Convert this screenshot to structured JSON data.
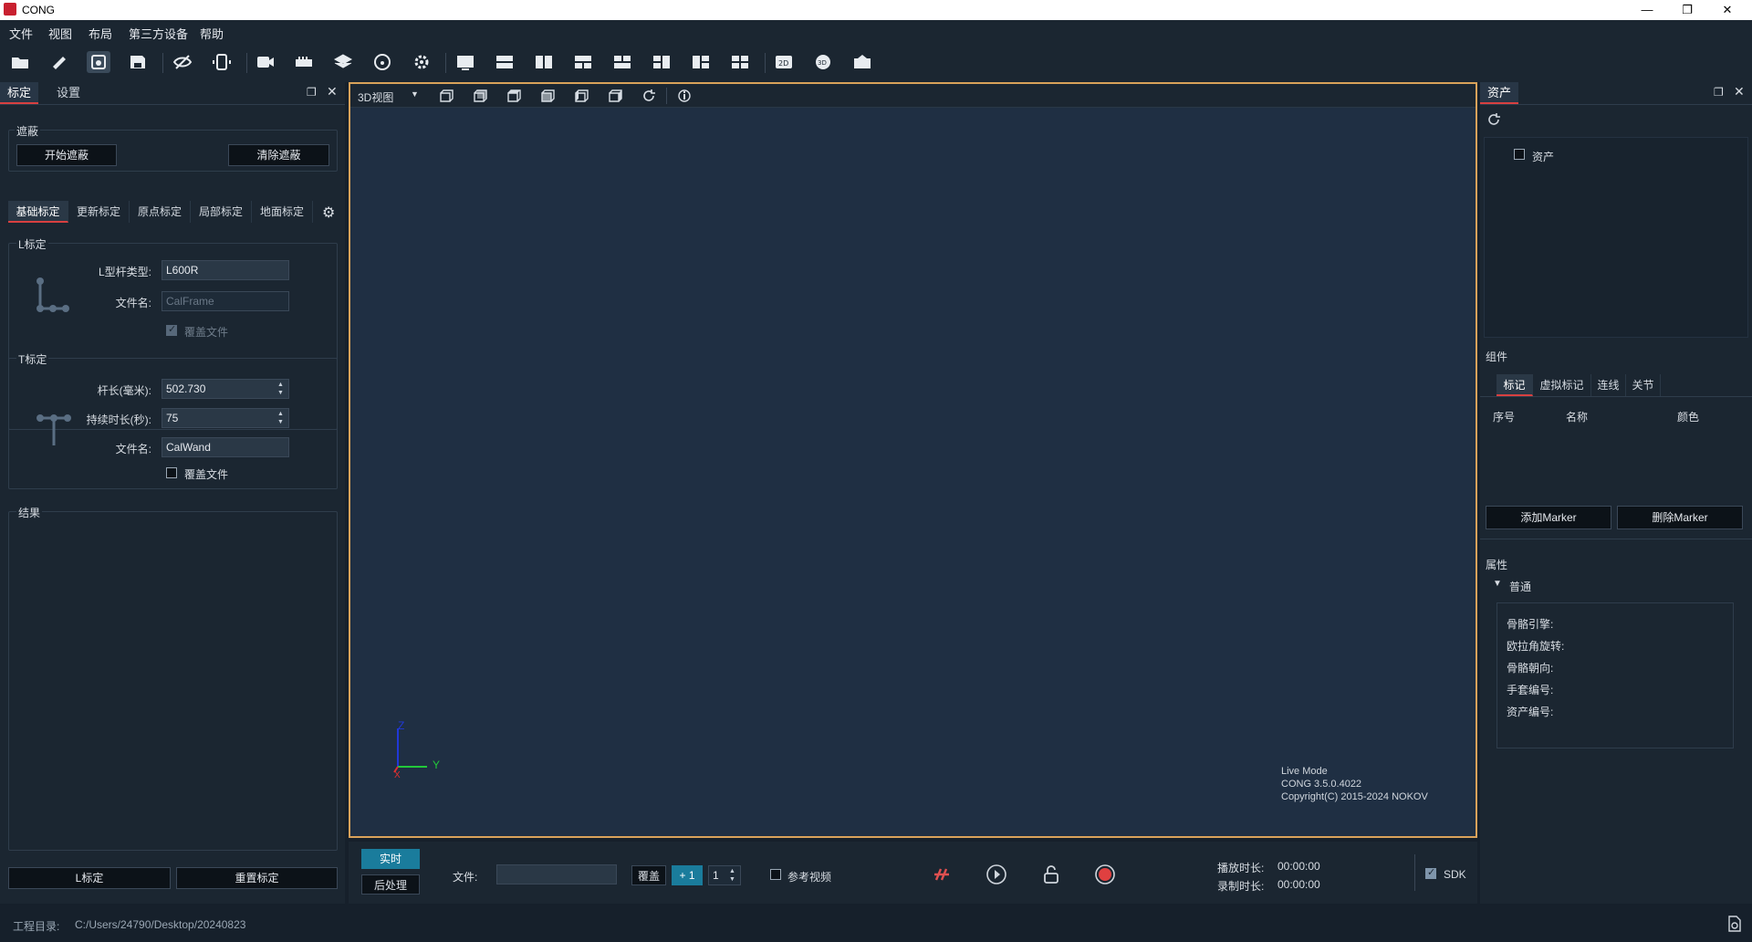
{
  "window": {
    "title": "CONG",
    "minimize": "—",
    "maximize": "❐",
    "close": "✕"
  },
  "menu": [
    "文件",
    "视图",
    "布局",
    "第三方设备",
    "帮助"
  ],
  "left_panel": {
    "tabs": [
      "标定",
      "设置"
    ],
    "mask": {
      "title": "遮蔽",
      "start_btn": "开始遮蔽",
      "clear_btn": "清除遮蔽"
    },
    "subtabs": [
      "基础标定",
      "更新标定",
      "原点标定",
      "局部标定",
      "地面标定"
    ],
    "l_cal": {
      "title": "L标定",
      "type_label": "L型杆类型:",
      "type_value": "L600R",
      "file_label": "文件名:",
      "file_placeholder": "CalFrame",
      "overwrite_label": "覆盖文件",
      "overwrite_checked": true
    },
    "t_cal": {
      "title": "T标定",
      "length_label": "杆长(毫米):",
      "length_value": "502.730",
      "duration_label": "持续时长(秒):",
      "duration_value": "75",
      "file_label": "文件名:",
      "file_value": "CalWand",
      "overwrite_label": "覆盖文件",
      "overwrite_checked": false
    },
    "result": {
      "title": "结果"
    },
    "l_cal_btn": "L标定",
    "reset_btn": "重置标定"
  },
  "viewport": {
    "view_select": "3D视图",
    "axis_z": "Z",
    "axis_y": "Y",
    "axis_x": "X",
    "info_mode": "Live Mode",
    "info_version": "CONG 3.5.0.4022",
    "info_copyright": "Copyright(C) 2015-2024 NOKOV"
  },
  "playbar": {
    "realtime_btn": "实时",
    "post_btn": "后处理",
    "file_label": "文件:",
    "file_value": "",
    "overlay_btn": "覆盖",
    "plus_btn": "+ 1",
    "count_value": "1",
    "ref_video_label": "参考视频",
    "play_duration_label": "播放时长:",
    "play_duration_value": "00:00:00",
    "record_duration_label": "录制时长:",
    "record_duration_value": "00:00:00",
    "sdk_label": "SDK"
  },
  "right_panel": {
    "tab": "资产",
    "asset_item": "资产",
    "components_title": "组件",
    "comp_tabs": [
      "标记",
      "虚拟标记",
      "连线",
      "关节"
    ],
    "columns": [
      "序号",
      "名称",
      "颜色"
    ],
    "add_marker_btn": "添加Marker",
    "del_marker_btn": "删除Marker",
    "props_title": "属性",
    "props_group": "普通",
    "props": [
      "骨骼引擎:",
      "欧拉角旋转:",
      "骨骼朝向:",
      "手套编号:",
      "资产编号:"
    ]
  },
  "statusbar": {
    "project_label": "工程目录:",
    "project_path": "C:/Users/24790/Desktop/20240823"
  },
  "colors": {
    "accent": "#d84040",
    "viewport_border": "#d9a25a",
    "realtime": "#1a7c9c"
  }
}
